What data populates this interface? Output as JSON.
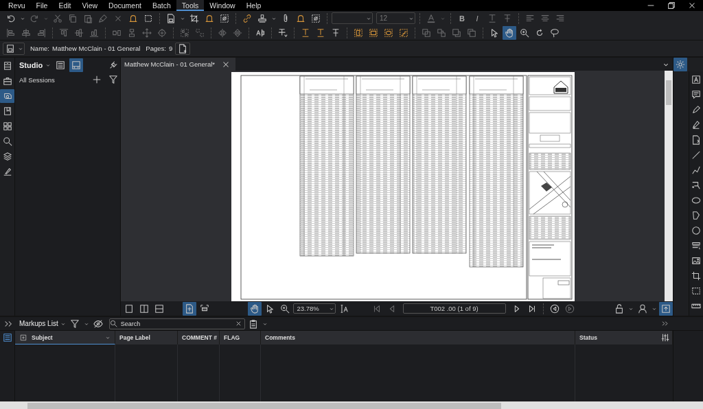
{
  "menu": [
    {
      "label": "Revu",
      "selected": false
    },
    {
      "label": "File",
      "selected": false
    },
    {
      "label": "Edit",
      "selected": false
    },
    {
      "label": "View",
      "selected": false
    },
    {
      "label": "Document",
      "selected": false
    },
    {
      "label": "Batch",
      "selected": false
    },
    {
      "label": "Tools",
      "selected": true
    },
    {
      "label": "Window",
      "selected": false
    },
    {
      "label": "Help",
      "selected": false
    }
  ],
  "toolbar": {
    "font_size": "12",
    "bold": "B",
    "italic": "I",
    "tools": [
      {
        "selected": false
      },
      {
        "selected": true
      },
      {
        "selected": false
      },
      {
        "selected": false
      },
      {
        "selected": false
      }
    ]
  },
  "document_bar": {
    "name_label": "Name:",
    "name": "Matthew McClain - 01 General",
    "pages_label": "Pages:",
    "pages": "9"
  },
  "left_strip": [
    {
      "selected": false
    },
    {
      "selected": false
    },
    {
      "selected": true
    },
    {
      "selected": false
    },
    {
      "selected": false
    },
    {
      "selected": false
    },
    {
      "selected": false
    },
    {
      "selected": false
    }
  ],
  "studio": {
    "title": "Studio",
    "view_buttons": [
      {
        "selected": false
      },
      {
        "selected": true
      }
    ],
    "sessions_label": "All Sessions"
  },
  "tabs": [
    {
      "label": "Matthew McClain - 01 General*",
      "selected": true
    }
  ],
  "nav": {
    "view_modes": [
      {
        "selected": false
      },
      {
        "selected": false
      },
      {
        "selected": false
      },
      {
        "selected": true
      },
      {
        "selected": false
      }
    ],
    "tools": [
      {
        "selected": true
      },
      {
        "selected": false
      },
      {
        "selected": false
      }
    ],
    "zoom": "23.78%",
    "page": "T002 .00 (1 of 9)",
    "sync_selected": true
  },
  "right_strip": {
    "top_selected": true
  },
  "markups": {
    "title": "Markups List",
    "search_placeholder": "Search",
    "columns": [
      "Subject",
      "Page Label",
      "COMMENT #",
      "FLAG",
      "Comments",
      "Status"
    ]
  }
}
